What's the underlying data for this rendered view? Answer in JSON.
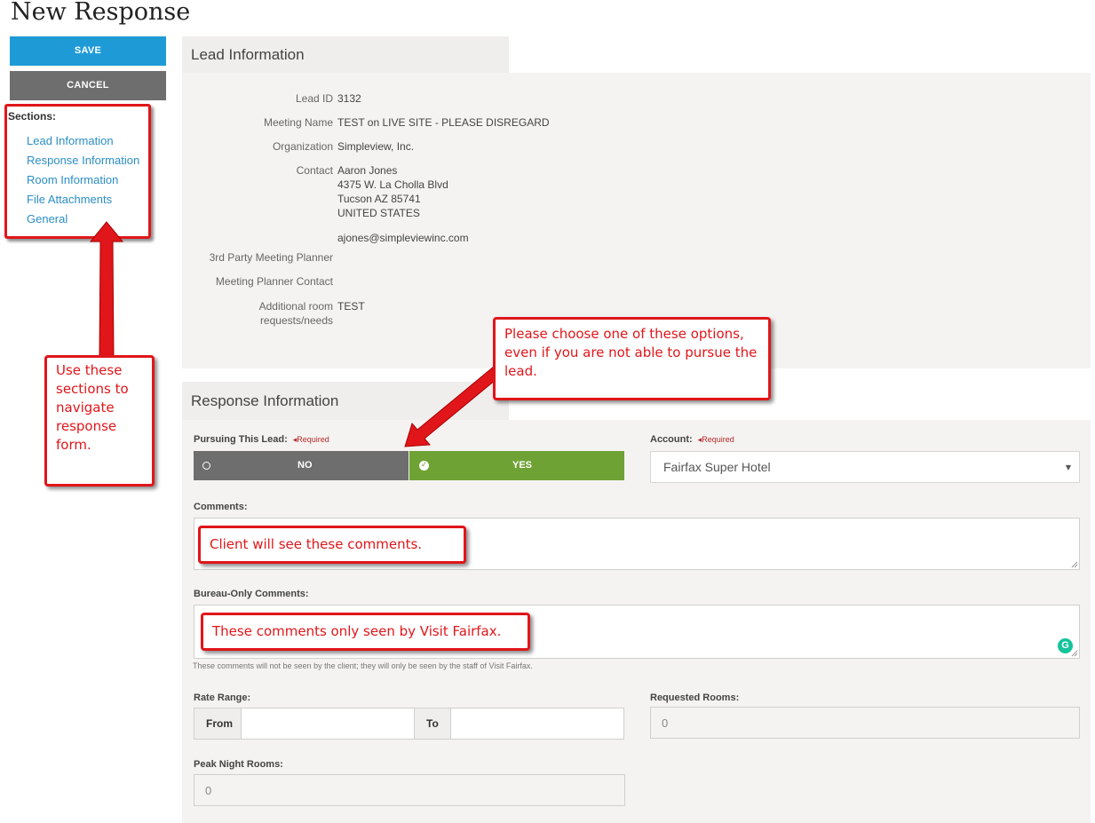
{
  "page": {
    "title": "New Response"
  },
  "actions": {
    "save": "SAVE",
    "cancel": "CANCEL"
  },
  "sections": {
    "label": "Sections:",
    "items": [
      "Lead Information",
      "Response Information",
      "Room Information",
      "File Attachments",
      "General"
    ]
  },
  "callouts": {
    "nav": "Use these sections to navigate response form.",
    "choose": "Please choose one of these options, even if you are not able to pursue the lead.",
    "client": "Client will see these comments.",
    "bureau": "These comments only seen by Visit Fairfax."
  },
  "lead": {
    "tab": "Lead Information",
    "lead_id_label": "Lead ID",
    "lead_id": "3132",
    "meeting_name_label": "Meeting Name",
    "meeting_name": "TEST on LIVE SITE - PLEASE DISREGARD",
    "organization_label": "Organization",
    "organization": "Simpleview, Inc.",
    "contact_label": "Contact",
    "contact_name": "Aaron Jones",
    "contact_street": "4375 W. La Cholla Blvd",
    "contact_city": "Tucson AZ 85741",
    "contact_country": "UNITED STATES",
    "contact_email": "ajones@simpleviewinc.com",
    "third_party_label": "3rd Party Meeting Planner",
    "planner_contact_label": "Meeting Planner Contact",
    "additional_label_1": "Additional room",
    "additional_label_2": "requests/needs",
    "additional": "TEST"
  },
  "response": {
    "tab": "Response Information",
    "pursuing_label": "Pursuing This Lead:",
    "required": "◂Required",
    "no": "NO",
    "yes": "YES",
    "selected": "YES",
    "account_label": "Account:",
    "account_value": "Fairfax Super Hotel",
    "comments_label": "Comments:",
    "bureau_label": "Bureau-Only Comments:",
    "bureau_hint": "These comments will not be seen by the client; they will only be seen by the staff of Visit Fairfax.",
    "rate_label": "Rate Range:",
    "from": "From",
    "to": "To",
    "requested_label": "Requested Rooms:",
    "requested_value": "0",
    "peak_label": "Peak Night Rooms:",
    "peak_value": "0"
  },
  "colors": {
    "save": "#1e9bd7",
    "cancel": "#6e6e6e",
    "yes": "#6fa234",
    "no": "#6e6e6e",
    "callout_red": "#e0161a",
    "link": "#2b8ec5"
  },
  "icons": {
    "no": "radio-empty-icon",
    "yes": "check-circle-icon",
    "grammarly": "grammarly-icon",
    "dropdown": "caret-down-icon"
  }
}
